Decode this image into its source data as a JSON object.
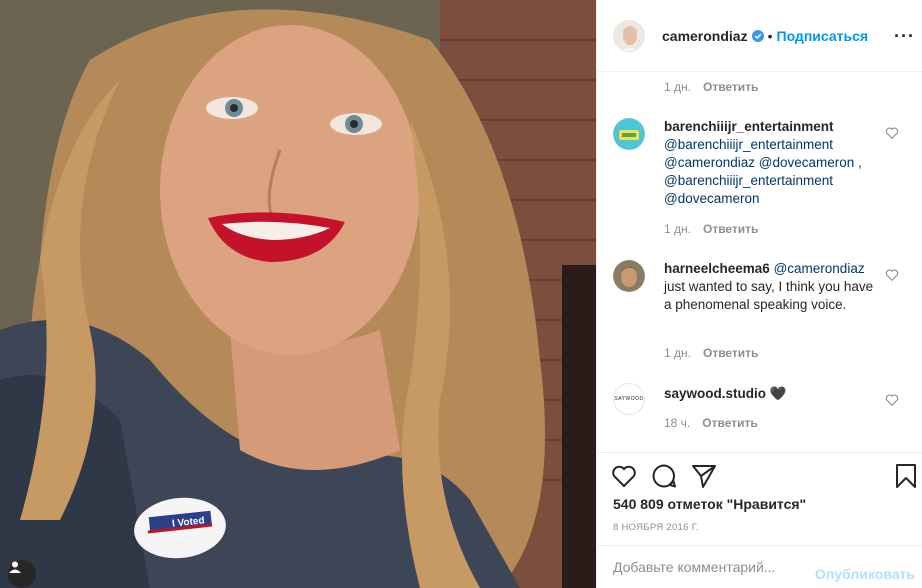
{
  "photo": {
    "sticker_text": "I Voted",
    "user_tag_icon": "user-icon"
  },
  "header": {
    "username": "camerondiaz",
    "verified_icon": "verified-badge-icon",
    "separator": "•",
    "follow_label": "Подписаться",
    "more_icon": "more-options-icon"
  },
  "comments": [
    {
      "id": "prev",
      "time": "1 дн.",
      "reply_label": "Ответить"
    },
    {
      "id": "barenchiiijr",
      "username": "barenchiiijr_entertainment",
      "text_lines": [
        "@barenchiiijr_entertainment",
        "@camerondiaz @dovecameron ,",
        "@barenchiiijr_entertainment",
        "@dovecameron"
      ],
      "time": "1 дн.",
      "reply_label": "Ответить"
    },
    {
      "id": "harneel",
      "username": "harneelcheema6",
      "mention": "@camerondiaz",
      "text": "just wanted to say, I think you have a phenomenal speaking voice.",
      "time": "1 дн.",
      "reply_label": "Ответить"
    },
    {
      "id": "saywood",
      "username": "saywood.studio",
      "emoji": "🖤",
      "avatar_text": "SAYWOOD",
      "time": "18 ч.",
      "reply_label": "Ответить"
    }
  ],
  "actions": {
    "like_icon": "heart-icon",
    "comment_icon": "comment-icon",
    "share_icon": "share-icon",
    "save_icon": "bookmark-icon",
    "likes_text": "540 809 отметок \"Нравится\"",
    "date_text": "8 НОЯБРЯ 2016 Г."
  },
  "add_comment": {
    "placeholder": "Добавьте комментарий...",
    "publish_label": "Опубликовать"
  },
  "colors": {
    "accent": "#0095f6",
    "publish_disabled": "#b2dffc",
    "mention": "#00376b",
    "muted": "#8e8e8e",
    "lips": "#c4122a"
  }
}
